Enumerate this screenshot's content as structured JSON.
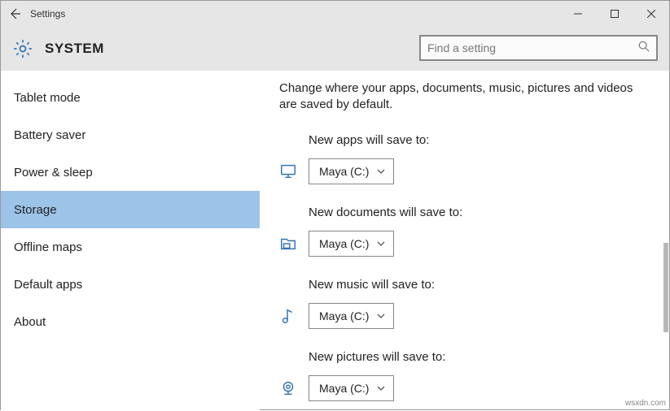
{
  "titlebar": {
    "title": "Settings"
  },
  "header": {
    "title": "SYSTEM",
    "search_placeholder": "Find a setting"
  },
  "sidebar": {
    "items": [
      {
        "label": "Tablet mode",
        "selected": false
      },
      {
        "label": "Battery saver",
        "selected": false
      },
      {
        "label": "Power & sleep",
        "selected": false
      },
      {
        "label": "Storage",
        "selected": true
      },
      {
        "label": "Offline maps",
        "selected": false
      },
      {
        "label": "Default apps",
        "selected": false
      },
      {
        "label": "About",
        "selected": false
      }
    ]
  },
  "content": {
    "description": "Change where your apps, documents, music, pictures and videos are saved by default.",
    "settings": [
      {
        "label": "New apps will save to:",
        "value": "Maya (C:)",
        "icon": "apps"
      },
      {
        "label": "New documents will save to:",
        "value": "Maya (C:)",
        "icon": "documents"
      },
      {
        "label": "New music will save to:",
        "value": "Maya (C:)",
        "icon": "music"
      },
      {
        "label": "New pictures will save to:",
        "value": "Maya (C:)",
        "icon": "pictures"
      }
    ]
  },
  "watermark": "wsxdn.com",
  "colors": {
    "accent": "#3373b6",
    "selection": "#9cc3e8"
  }
}
